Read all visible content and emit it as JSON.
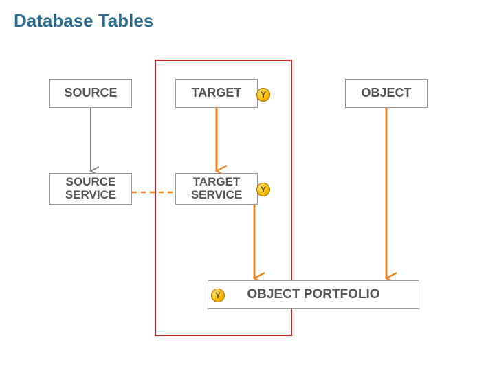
{
  "title": "Database Tables",
  "boxes": {
    "source": "SOURCE",
    "target": "TARGET",
    "object": "OBJECT",
    "source_service": "SOURCE SERVICE",
    "target_service": "TARGET SERVICE",
    "object_portfolio": "OBJECT PORTFOLIO"
  },
  "badge_glyph": "Y",
  "colors": {
    "title": "#2a6d8f",
    "group_border": "#c1272d",
    "conn_gray": "#808080",
    "conn_orange": "#f58220",
    "box_text": "#555555"
  }
}
